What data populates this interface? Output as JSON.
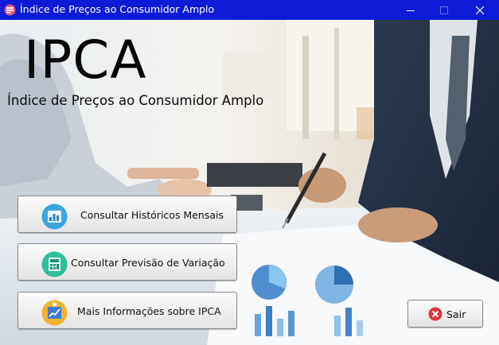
{
  "window": {
    "title": "Índice de Preços ao Consumidor Amplo",
    "icon": "app-icon",
    "controls": [
      "minimize-icon",
      "maximize-icon",
      "close-icon"
    ],
    "titlebar_color": "#0c1bd6"
  },
  "header": {
    "title": "IPCA",
    "subtitle": "Índice de Preços ao Consumidor Amplo"
  },
  "menu": {
    "historicos": {
      "label": "Consultar Históricos Mensais",
      "icon": "bar-chart-icon"
    },
    "previsao": {
      "label": "Consultar Previsão de Variação",
      "icon": "calculator-icon"
    },
    "informacoes": {
      "label": "Mais Informações sobre IPCA",
      "icon": "growth-chart-icon"
    }
  },
  "exit": {
    "label": "Sair",
    "icon": "close-circle-icon",
    "color": "#d9363e"
  }
}
